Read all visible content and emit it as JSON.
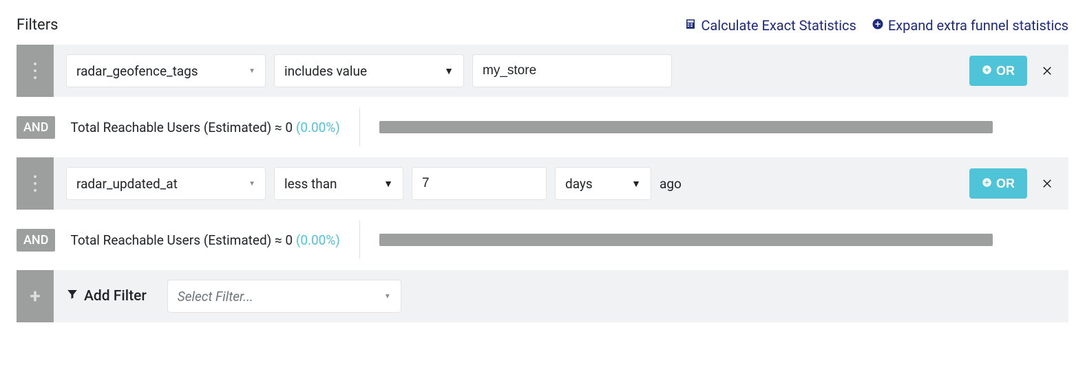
{
  "title": "Filters",
  "header_links": {
    "calc": "Calculate Exact Statistics",
    "expand": "Expand extra funnel statistics"
  },
  "or_label": "OR",
  "and_label": "AND",
  "stats": {
    "prefix": "Total Reachable Users (Estimated) ≈ ",
    "value": "0",
    "pct": "(0.00%)"
  },
  "filters": [
    {
      "field": "radar_geofence_tags",
      "operator": "includes value",
      "value": "my_store"
    },
    {
      "field": "radar_updated_at",
      "operator": "less than",
      "value": "7",
      "unit": "days",
      "suffix": "ago"
    }
  ],
  "add_filter": {
    "label": "Add Filter",
    "placeholder": "Select Filter..."
  }
}
